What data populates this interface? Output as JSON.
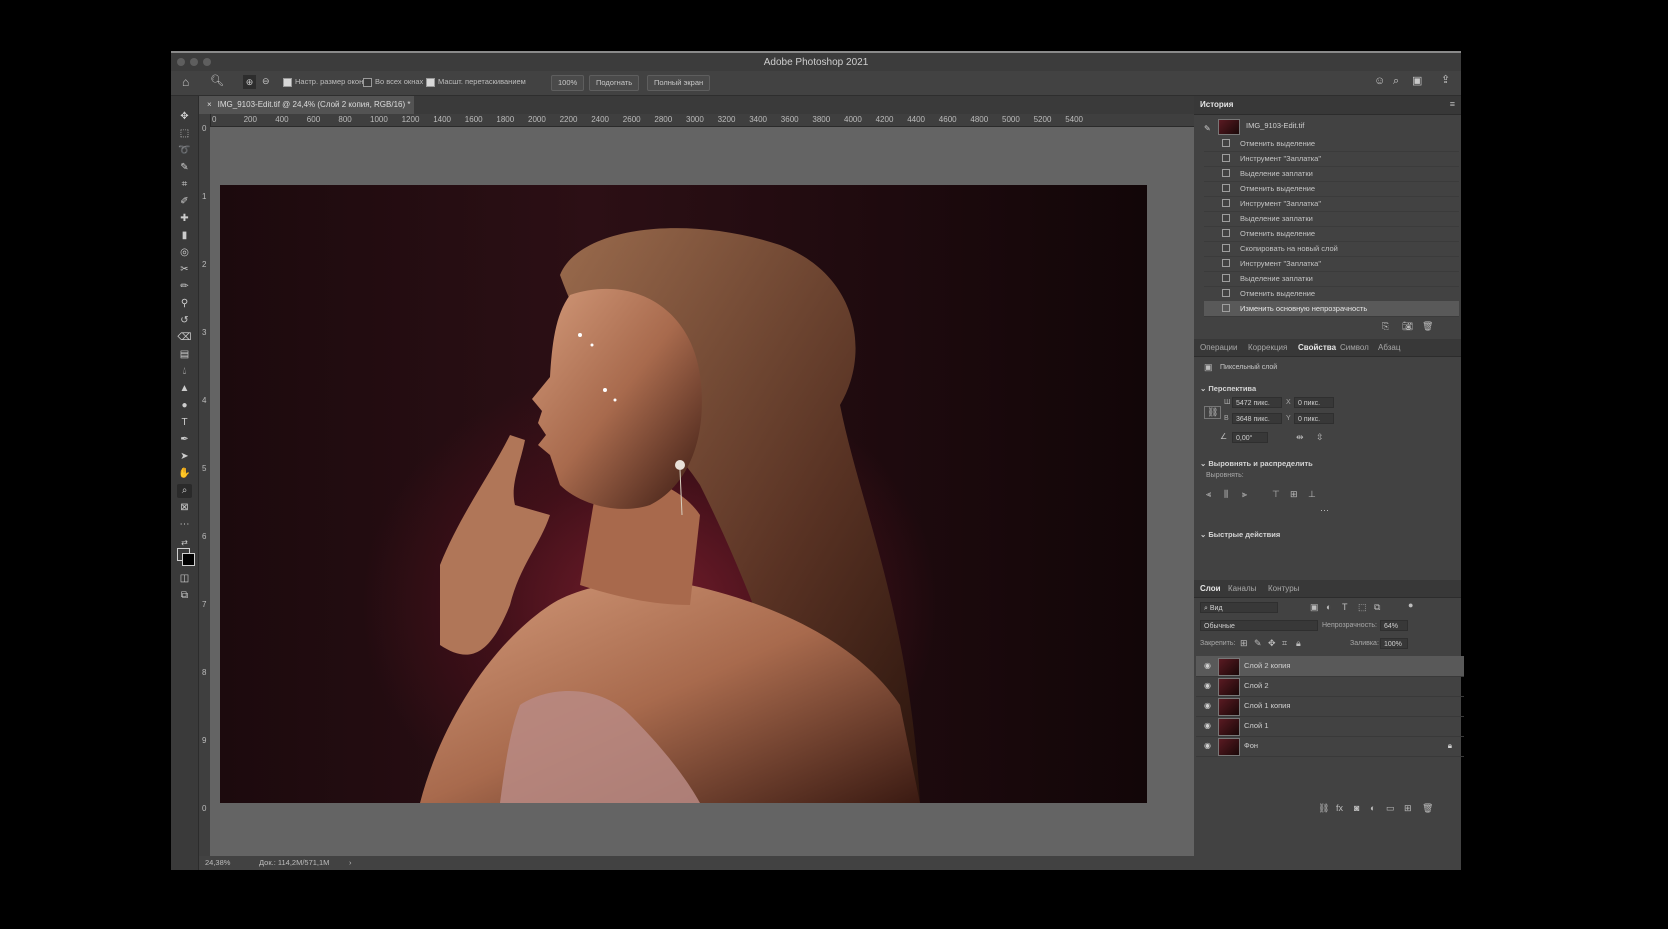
{
  "window": {
    "title": "Adobe Photoshop 2021"
  },
  "options_bar": {
    "resize_windows": "Настр. размер окон",
    "all_windows": "Во всех окнах",
    "scrubby_zoom": "Масшт. перетаскиванием",
    "zoom_pct": "100%",
    "fit_label": "Подогнать",
    "fullscreen_label": "Полный экран"
  },
  "document": {
    "tab_title": "IMG_9103-Edit.tif @ 24,4% (Слой 2 копия, RGB/16) *"
  },
  "ruler_h": [
    "0",
    "200",
    "400",
    "600",
    "800",
    "1000",
    "1200",
    "1400",
    "1600",
    "1800",
    "2000",
    "2200",
    "2400",
    "2600",
    "2800",
    "3000",
    "3200",
    "3400",
    "3600",
    "3800",
    "4000",
    "4200",
    "4400",
    "4600",
    "4800",
    "5000",
    "5200",
    "5400"
  ],
  "ruler_v": [
    "0",
    "1",
    "2",
    "3",
    "4",
    "5",
    "6",
    "7",
    "8",
    "9",
    "0"
  ],
  "status": {
    "zoom": "24,38%",
    "doc": "Док.: 114,2M/571,1M"
  },
  "history": {
    "tab": "История",
    "snapshot": "IMG_9103-Edit.tif",
    "items": [
      "Отменить выделение",
      "Инструмент \"Заплатка\"",
      "Выделение заплатки",
      "Отменить выделение",
      "Инструмент \"Заплатка\"",
      "Выделение заплатки",
      "Отменить выделение",
      "Скопировать на новый слой",
      "Инструмент \"Заплатка\"",
      "Выделение заплатки",
      "Отменить выделение",
      "Изменить основную непрозрачность"
    ]
  },
  "props": {
    "tabs": [
      "Операции",
      "Коррекция",
      "Свойства",
      "Символ",
      "Абзац"
    ],
    "active_tab": "Свойства",
    "layer_type": "Пиксельный слой",
    "section_transform": "Перспектива",
    "w_label": "Ш",
    "w_value": "5472 пикс.",
    "h_label": "В",
    "h_value": "3648 пикс.",
    "x_label": "X",
    "x_value": "0 пикс.",
    "y_label": "Y",
    "y_value": "0 пикс.",
    "angle_value": "0,00°",
    "section_align": "Выровнять и распределить",
    "align_label": "Выровнять:",
    "section_quick": "Быстрые действия"
  },
  "layers": {
    "tabs": [
      "Слои",
      "Каналы",
      "Контуры"
    ],
    "filter_label": "Вид",
    "blend_mode": "Обычные",
    "opacity_label": "Непрозрачность:",
    "opacity_value": "64%",
    "lock_label": "Закрепить:",
    "fill_label": "Заливка:",
    "fill_value": "100%",
    "items": [
      {
        "name": "Слой 2 копия",
        "selected": true,
        "locked": false
      },
      {
        "name": "Слой 2",
        "selected": false,
        "locked": false
      },
      {
        "name": "Слой 1 копия",
        "selected": false,
        "locked": false
      },
      {
        "name": "Слой 1",
        "selected": false,
        "locked": false
      },
      {
        "name": "Фон",
        "selected": false,
        "locked": true
      }
    ]
  },
  "colors": {
    "accent_bg": "#535353",
    "panel_bg": "#424242",
    "selected_row": "#595959"
  }
}
